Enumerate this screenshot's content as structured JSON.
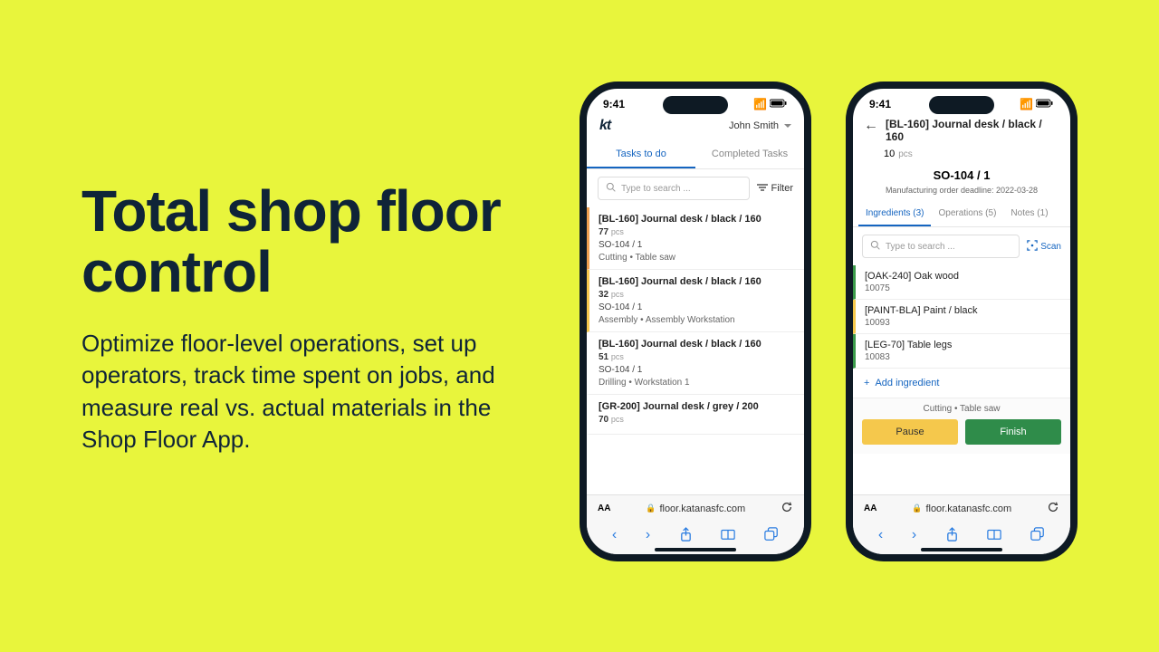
{
  "marketing": {
    "headline": "Total shop floor control",
    "body": "Optimize floor-level operations, set up operators, track time spent on jobs, and measure real vs. actual materials in the Shop Floor App."
  },
  "status": {
    "time": "9:41"
  },
  "browser": {
    "url": "floor.katanasfc.com",
    "aa": "AA"
  },
  "phone1": {
    "logo": "kt",
    "user": "John Smith",
    "tabs": {
      "todo": "Tasks to do",
      "done": "Completed Tasks"
    },
    "search_placeholder": "Type to search ...",
    "filter": "Filter",
    "tasks": [
      {
        "title": "[BL-160] Journal desk / black / 160",
        "qty": "77",
        "unit": "pcs",
        "so": "SO-104 / 1",
        "op": "Cutting  •  Table saw",
        "accent": "orange"
      },
      {
        "title": "[BL-160] Journal desk / black / 160",
        "qty": "32",
        "unit": "pcs",
        "so": "SO-104 / 1",
        "op": "Assembly  •  Assembly Workstation",
        "accent": "yellow"
      },
      {
        "title": "[BL-160] Journal desk / black / 160",
        "qty": "51",
        "unit": "pcs",
        "so": "SO-104 / 1",
        "op": "Drilling  •  Workstation 1",
        "accent": ""
      },
      {
        "title": "[GR-200] Journal desk / grey / 200",
        "qty": "70",
        "unit": "pcs",
        "so": "",
        "op": "",
        "accent": ""
      }
    ]
  },
  "phone2": {
    "title": "[BL-160] Journal desk / black / 160",
    "qty": "10",
    "unit": "pcs",
    "so": "SO-104 / 1",
    "deadline": "Manufacturing order deadline: 2022-03-28",
    "tabs": {
      "ingredients": "Ingredients (3)",
      "operations": "Operations (5)",
      "notes": "Notes (1)"
    },
    "search_placeholder": "Type to search ...",
    "scan": "Scan",
    "ingredients": [
      {
        "name": "[OAK-240] Oak wood",
        "code": "10075",
        "accent": "green"
      },
      {
        "name": "[PAINT-BLA] Paint / black",
        "code": "10093",
        "accent": "yellow"
      },
      {
        "name": "[LEG-70] Table legs",
        "code": "10083",
        "accent": "green"
      }
    ],
    "add_ingredient": "Add ingredient",
    "op_label": "Cutting  •  Table saw",
    "pause": "Pause",
    "finish": "Finish"
  }
}
